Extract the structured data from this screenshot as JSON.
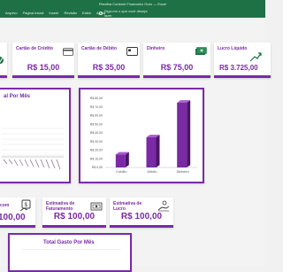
{
  "window": {
    "title": "Planilha Controle Financeiro Ouro — Excel",
    "menu": [
      "Arquivo",
      "Página Inicial",
      "Inserir",
      "Revisão",
      "Exibir",
      "Ajuda"
    ],
    "search_placeholder": "Diga-me o que você deseja fazer"
  },
  "cards_top": [
    {
      "label": "Cartão de Crédito",
      "value": "R$ 15,00",
      "icon": "credit-card-icon"
    },
    {
      "label": "Cartão de Débito",
      "value": "R$ 35,00",
      "icon": "debit-card-icon"
    },
    {
      "label": "Dinheiro",
      "value": "R$ 75,00",
      "icon": "money-icon"
    },
    {
      "label": "Lucro Líquido",
      "value": "R$ 3.725,00",
      "icon": "growth-chart-icon"
    }
  ],
  "cards_bottom": [
    {
      "label": "com",
      "value": "100,00",
      "icon": "money-hand-icon"
    },
    {
      "label": "Estimativa de Faturamento",
      "value": "R$ 100,00",
      "icon": "cash-stack-icon"
    },
    {
      "label": "Estimativa de Lucro",
      "value": "R$ 100,00",
      "icon": "hand-money-icon"
    }
  ],
  "left_chart": {
    "title": "al Por Mês"
  },
  "bottom_chart": {
    "title": "Total Gasto Por Mês"
  },
  "colors": {
    "accent": "#7a2aa5",
    "excel_green": "#1e7145"
  },
  "chart_data": [
    {
      "type": "bar",
      "title": "",
      "categories": [
        "Crédito",
        "Débito",
        "Dinheiro"
      ],
      "values": [
        15,
        35,
        75
      ],
      "ylim": [
        0,
        80
      ],
      "y_ticks": [
        "R$ 0,00",
        "R$ 10,00",
        "R$ 20,00",
        "R$ 30,00",
        "R$ 40,00",
        "R$ 50,00",
        "R$ 60,00",
        "R$ 70,00",
        "R$ 80,00"
      ],
      "grid": false
    }
  ]
}
